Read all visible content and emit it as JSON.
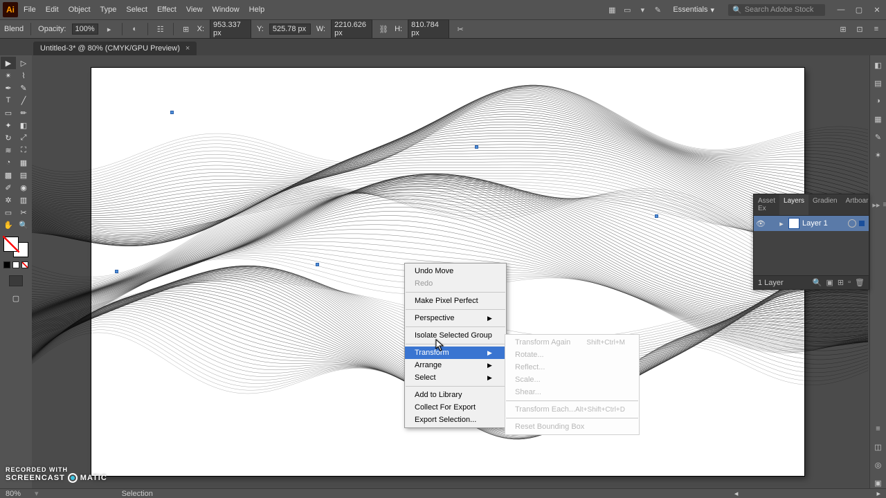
{
  "menu": {
    "items": [
      "File",
      "Edit",
      "Object",
      "Type",
      "Select",
      "Effect",
      "View",
      "Window",
      "Help"
    ]
  },
  "workspace_switcher": {
    "label": "Essentials"
  },
  "search": {
    "placeholder": "Search Adobe Stock"
  },
  "control_bar": {
    "blend_label": "Blend",
    "opacity_label": "Opacity:",
    "opacity_value": "100%",
    "x_label": "X:",
    "x_value": "953.337 px",
    "y_label": "Y:",
    "y_value": "525.78 px",
    "w_label": "W:",
    "w_value": "2210.626 px",
    "h_label": "H:",
    "h_value": "810.784 px"
  },
  "doc_tab": {
    "title": "Untitled-3* @ 80% (CMYK/GPU Preview)"
  },
  "context_menu": {
    "items": [
      {
        "label": "Undo Move",
        "disabled": false
      },
      {
        "label": "Redo",
        "disabled": true
      },
      {
        "sep": true
      },
      {
        "label": "Make Pixel Perfect"
      },
      {
        "sep": true
      },
      {
        "label": "Perspective",
        "arrow": true
      },
      {
        "sep": true
      },
      {
        "label": "Isolate Selected Group"
      },
      {
        "sep": true
      },
      {
        "label": "Transform",
        "arrow": true,
        "hover": true
      },
      {
        "label": "Arrange",
        "arrow": true
      },
      {
        "label": "Select",
        "arrow": true
      },
      {
        "sep": true
      },
      {
        "label": "Add to Library"
      },
      {
        "label": "Collect For Export"
      },
      {
        "label": "Export Selection..."
      }
    ]
  },
  "submenu": {
    "items": [
      {
        "label": "Transform Again",
        "shortcut": "Shift+Ctrl+M"
      },
      {
        "label": "Rotate..."
      },
      {
        "label": "Reflect..."
      },
      {
        "label": "Scale..."
      },
      {
        "label": "Shear..."
      },
      {
        "sep": true
      },
      {
        "label": "Transform Each...",
        "shortcut": "Alt+Shift+Ctrl+D"
      },
      {
        "sep": true
      },
      {
        "label": "Reset Bounding Box"
      }
    ]
  },
  "panel": {
    "tabs": [
      "Asset Ex",
      "Layers",
      "Gradien",
      "Artboar"
    ],
    "active_tab": 1,
    "layer_name": "Layer 1",
    "footer_text": "1 Layer"
  },
  "status": {
    "zoom": "80%",
    "tool": "Selection"
  },
  "watermark": {
    "small": "RECORDED WITH",
    "brand_a": "SCREENCAST",
    "brand_b": "MATIC"
  }
}
